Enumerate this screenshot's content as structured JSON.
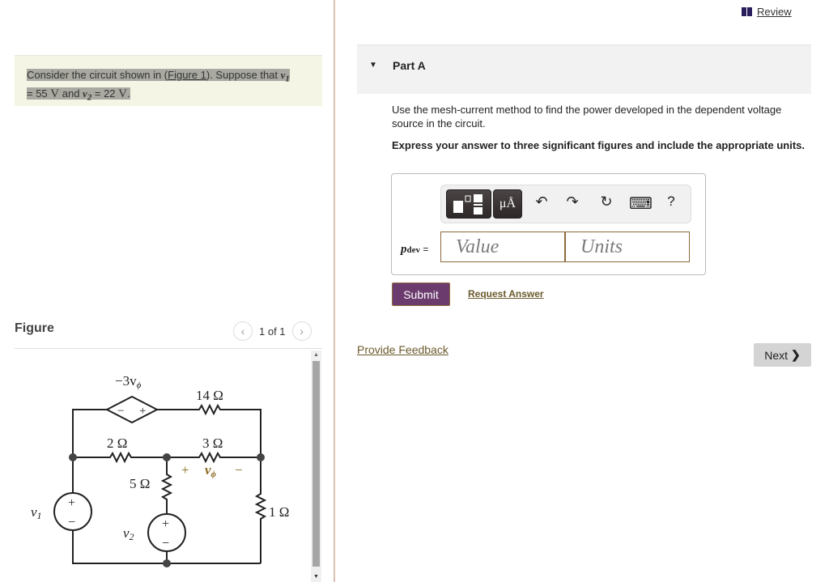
{
  "problem": {
    "prefix": "Consider the circuit shown in (",
    "figure_link": "Figure 1",
    "mid": "). Suppose that ",
    "v1_symbol": "v",
    "v1_sub": "1",
    "eq1": " = 55 ",
    "unit1": "V",
    "and": " and ",
    "v2_symbol": "v",
    "v2_sub": "2",
    "eq2": " = 22 ",
    "unit2": "V",
    "end": "."
  },
  "figure": {
    "title": "Figure",
    "pager_text": "1 of 1",
    "prev_icon": "‹",
    "next_icon": "›",
    "circuit": {
      "dependent_source_label": "−3v",
      "dependent_source_sub": "ϕ",
      "dep_minus": "−",
      "dep_plus": "+",
      "r14": "14 Ω",
      "r2": "2 Ω",
      "r3": "3 Ω",
      "r5": "5 Ω",
      "r1": "1 Ω",
      "vphi_plus": "+",
      "vphi_label": "v",
      "vphi_sub": "ϕ",
      "vphi_minus": "−",
      "v1_label": "v",
      "v1_sub": "1",
      "v2_label": "v",
      "v2_sub": "2",
      "src_plus": "+",
      "src_minus": "−",
      "accent_color": "#8a6a1e"
    }
  },
  "header": {
    "review_label": "Review",
    "review_icon": "book-icon"
  },
  "part": {
    "title": "Part A",
    "instruction": "Use the mesh-current method to find the power developed in the dependent voltage source in the circuit.",
    "instruction_bold": "Express your answer to three significant figures and include the appropriate units."
  },
  "answer": {
    "label_var": "p",
    "label_sub": "dev",
    "label_eq": " =",
    "value_placeholder": "Value",
    "units_placeholder": "Units",
    "toolbar": {
      "templates_icon": "templates-icon",
      "units_button": "μÅ",
      "undo": "↶",
      "redo": "↷",
      "reset": "↻",
      "keyboard": "⌨",
      "help": "?"
    }
  },
  "actions": {
    "submit": "Submit",
    "request_answer": "Request Answer",
    "provide_feedback": "Provide Feedback",
    "next": "Next",
    "next_icon": "❯"
  },
  "colors": {
    "submit_bg": "#6b3b6e",
    "link_color": "#6b5a2c",
    "problem_bg": "#f5f5e6"
  }
}
